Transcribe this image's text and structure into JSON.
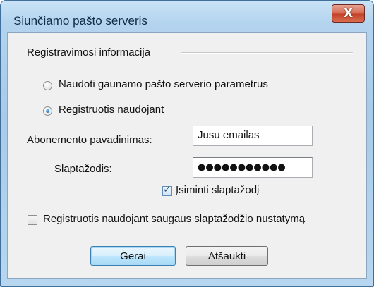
{
  "window": {
    "title": "Siunčiamo pašto serveris",
    "close_glyph": "X"
  },
  "group": {
    "label": "Registravimosi informacija"
  },
  "radios": [
    {
      "label": "Naudoti gaunamo pašto serverio parametrus",
      "checked": false
    },
    {
      "label": "Registruotis naudojant",
      "checked": true
    }
  ],
  "fields": {
    "account_label": "Abonemento pavadinimas:",
    "account_value": "Jusu emailas",
    "password_label": "Slaptažodis:",
    "password_value": "●●●●●●●●●●●"
  },
  "remember": {
    "label": "Įsiminti slaptažodį",
    "checked": true,
    "check_glyph": "✓"
  },
  "spa": {
    "label": "Registruotis naudojant saugaus slaptažodžio nustatymą",
    "checked": false
  },
  "buttons": {
    "ok": "Gerai",
    "cancel": "Atšaukti"
  }
}
